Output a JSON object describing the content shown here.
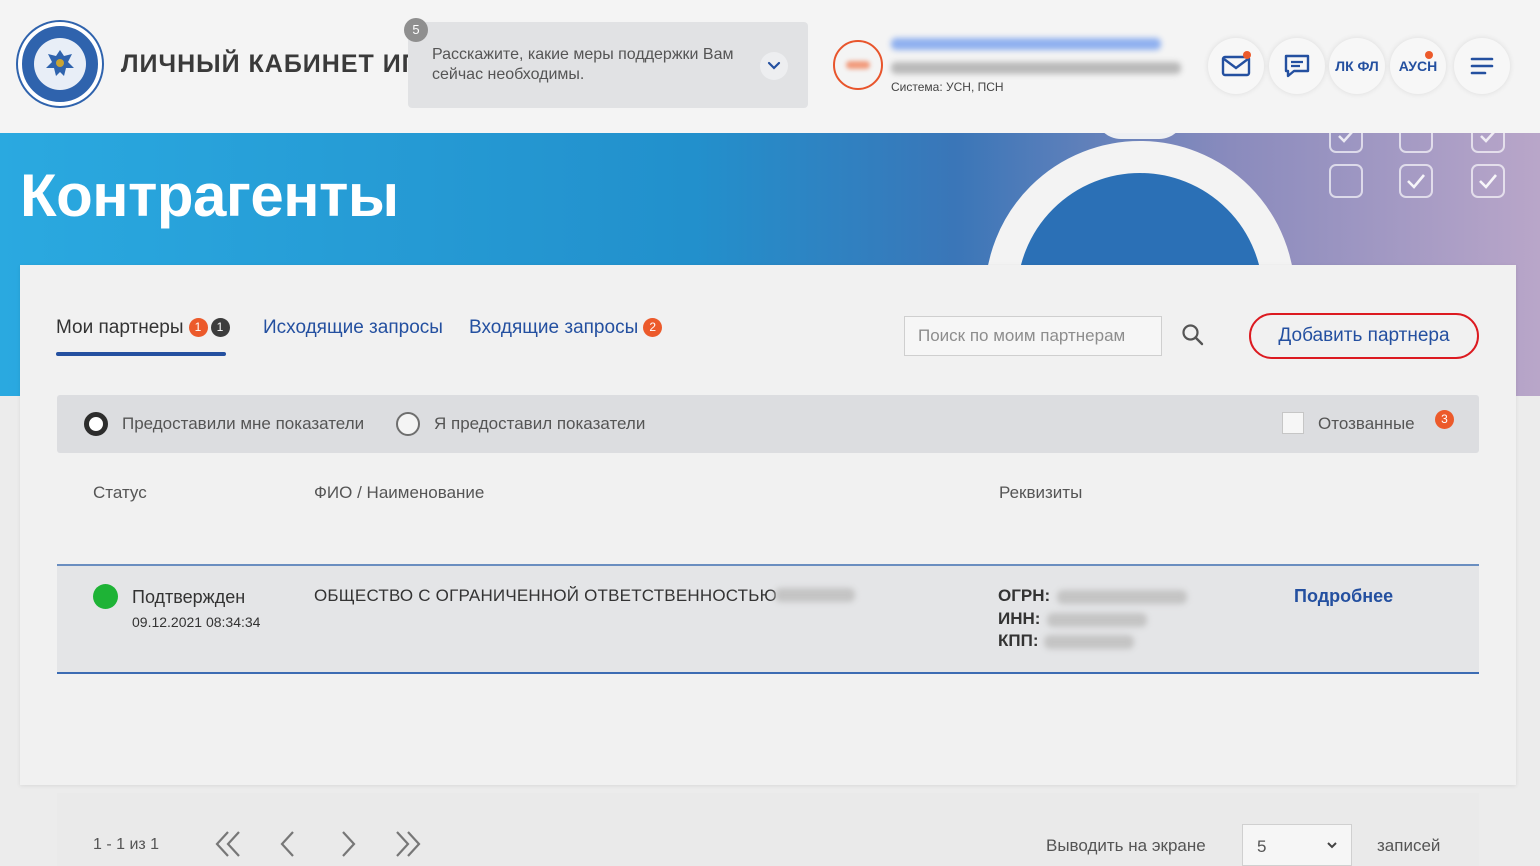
{
  "header": {
    "brand": "ЛИЧНЫЙ КАБИНЕТ ИП",
    "survey": {
      "badge": "5",
      "text": "Расскажите, какие меры поддержки Вам сейчас необходимы."
    },
    "user": {
      "system": "Система: УСН, ПСН"
    },
    "buttons": {
      "lk_fl": "ЛК ФЛ",
      "ausn": "АУСН"
    }
  },
  "hero": {
    "title": "Контрагенты"
  },
  "tabs": [
    {
      "label": "Мои партнеры",
      "count_new": "1",
      "count": "1"
    },
    {
      "label": "Исходящие запросы"
    },
    {
      "label": "Входящие запросы",
      "count_new": "2"
    }
  ],
  "search": {
    "placeholder": "Поиск по моим партнерам"
  },
  "add_partner_label": "Добавить партнера",
  "filters": {
    "radio_received": "Предоставили мне показатели",
    "radio_provided": "Я предоставил показатели",
    "recalled_label": "Отозванные",
    "recalled_count": "3"
  },
  "table": {
    "headers": {
      "status": "Статус",
      "name": "ФИО / Наименование",
      "requisites": "Реквизиты"
    },
    "rows": [
      {
        "status": "Подтвержден",
        "date": "09.12.2021 08:34:34",
        "name": "ОБЩЕСТВО С ОГРАНИЧЕННОЙ ОТВЕТСТВЕННОСТЬЮ",
        "ogrn_label": "ОГРН:",
        "inn_label": "ИНН:",
        "kpp_label": "КПП:",
        "more_label": "Подробнее"
      }
    ]
  },
  "pagination": {
    "range": "1 - 1 из 1",
    "per_page_label": "Выводить на экране",
    "per_page_value": "5",
    "records_label": "записей"
  },
  "colors": {
    "brand_blue": "#2450a0",
    "accent_orange": "#ec5a2b",
    "status_green": "#1eb336",
    "highlight_red": "#dc1a20"
  }
}
